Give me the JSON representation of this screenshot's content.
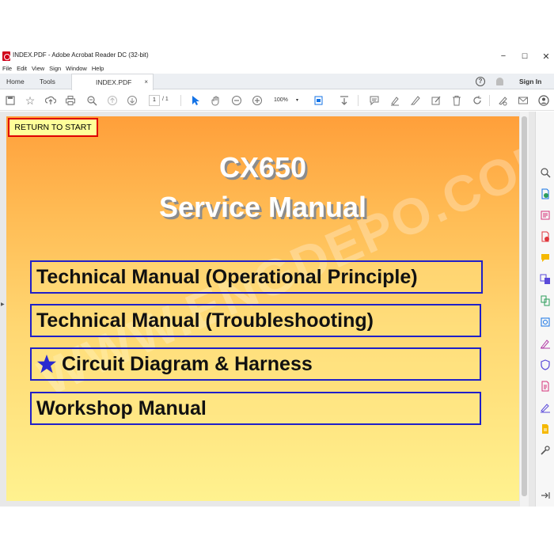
{
  "window": {
    "title": "INDEX.PDF - Adobe Acrobat Reader DC (32-bit)",
    "controls": {
      "minimize": "−",
      "maximize": "☐",
      "close": "✕"
    }
  },
  "menu": [
    "File",
    "Edit",
    "View",
    "Sign",
    "Window",
    "Help"
  ],
  "tabs": {
    "home": "Home",
    "tools": "Tools",
    "document": "INDEX.PDF",
    "close": "×"
  },
  "tabbar_right": {
    "help": "?",
    "signin": "Sign In"
  },
  "toolbar": {
    "page_current": "1",
    "page_total": "/ 1",
    "zoom": "100%"
  },
  "document": {
    "return_button": "RETURN TO START",
    "title_line1": "CX650",
    "title_line2": "Service Manual",
    "watermark": "WWW.ENGDEPO.COM",
    "links": [
      "Technical Manual (Operational Principle)",
      "Technical Manual (Troubleshooting)",
      "Circuit Diagram & Harness",
      "Workshop Manual"
    ]
  },
  "colors": {
    "accent": "#1473e6",
    "link_border": "#2020c8",
    "return_border": "#e00000",
    "star": "#2a2ad0"
  },
  "icons": {
    "toolbar": [
      "save-icon",
      "bookmark-star-icon",
      "upload-cloud-icon",
      "print-icon",
      "zoom-search-icon",
      "page-up-icon",
      "page-down-icon",
      "select-arrow-icon",
      "hand-icon",
      "zoom-out-icon",
      "zoom-in-icon",
      "fit-page-icon",
      "scroll-mode-icon",
      "comment-icon",
      "highlight-pen-icon",
      "draw-icon",
      "sign-icon",
      "trash-icon",
      "rotate-icon",
      "fill-sign-icon",
      "email-icon",
      "account-icon"
    ],
    "right_panel": [
      "search-zoom-icon",
      "export-pdf-icon",
      "edit-pdf-icon",
      "create-pdf-icon",
      "comment-icon",
      "combine-files-icon",
      "organize-pages-icon",
      "enhance-scans-icon",
      "fill-sign-icon",
      "protect-icon",
      "send-file-icon",
      "sign-icon",
      "more-tools-icon",
      "collapse-panel-icon"
    ]
  }
}
